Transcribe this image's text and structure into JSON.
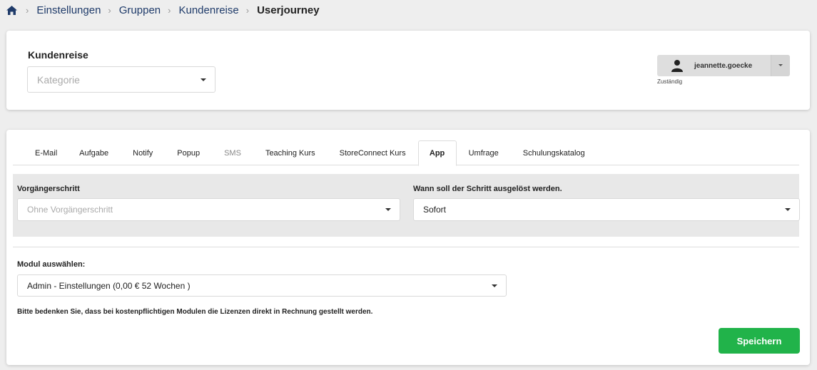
{
  "breadcrumb": {
    "items": [
      "Einstellungen",
      "Gruppen",
      "Kundenreise"
    ],
    "current": "Userjourney"
  },
  "header": {
    "title": "Kundenreise",
    "kategorie_placeholder": "Kategorie",
    "user_name": "jeannette.goecke",
    "user_role": "Zuständig"
  },
  "tabs": [
    {
      "label": "E-Mail"
    },
    {
      "label": "Aufgabe"
    },
    {
      "label": "Notify"
    },
    {
      "label": "Popup"
    },
    {
      "label": "SMS"
    },
    {
      "label": "Teaching Kurs"
    },
    {
      "label": "StoreConnect Kurs"
    },
    {
      "label": "App"
    },
    {
      "label": "Umfrage"
    },
    {
      "label": "Schulungskatalog"
    }
  ],
  "form": {
    "vorgaenger_label": "Vorgängerschritt",
    "vorgaenger_placeholder": "Ohne Vorgängerschritt",
    "wann_label": "Wann soll der Schritt ausgelöst werden.",
    "wann_value": "Sofort",
    "modul_label": "Modul auswählen:",
    "modul_value": "Admin - Einstellungen (0,00 € 52 Wochen )",
    "hint": "Bitte bedenken Sie, dass bei kostenpflichtigen Modulen die Lizenzen direkt in Rechnung gestellt werden.",
    "save_label": "Speichern"
  },
  "colors": {
    "save_button": "#21b34a",
    "breadcrumb_link": "#1f3b6a"
  }
}
